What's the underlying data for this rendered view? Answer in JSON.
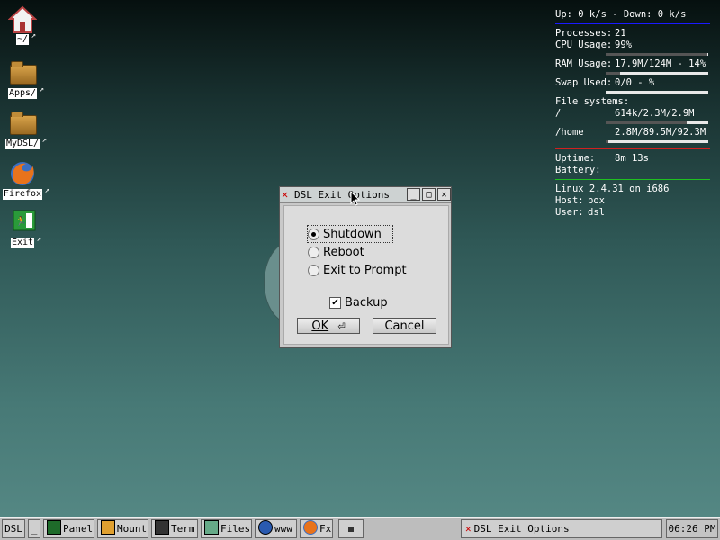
{
  "desktop_icons": [
    {
      "label": "~/",
      "icon": "home-icon"
    },
    {
      "label": "Apps/",
      "icon": "folder-icon"
    },
    {
      "label": "MyDSL/",
      "icon": "folder-icon"
    },
    {
      "label": "Firefox",
      "icon": "firefox-icon"
    },
    {
      "label": "Exit",
      "icon": "exit-icon"
    }
  ],
  "monitor": {
    "network": "Up: 0 k/s - Down: 0 k/s",
    "processes_label": "Processes:",
    "processes": "21",
    "cpu_label": "CPU Usage:",
    "cpu": "99%",
    "cpu_fraction": 0.99,
    "ram_label": "RAM Usage:",
    "ram": "17.9M/124M - 14%",
    "ram_fraction": 0.14,
    "swap_label": "Swap Used:",
    "swap": "0/0 - %",
    "swap_fraction": 0,
    "fs_label": "File systems:",
    "fs_root_label": "/",
    "fs_root": "614k/2.3M/2.9M",
    "fs_root_fraction": 0.79,
    "fs_home_label": "/home",
    "fs_home": "2.8M/89.5M/92.3M",
    "fs_home_fraction": 0.03,
    "uptime_label": "Uptime:",
    "uptime": "8m 13s",
    "battery_label": "Battery:",
    "kernel": "Linux 2.4.31 on i686",
    "host_label": "Host:",
    "host": "box",
    "user_label": "User:",
    "user": "dsl",
    "colors": {
      "blue_line": "#1a1aff",
      "red_line": "#d02020",
      "green_line": "#20c020"
    }
  },
  "dialog": {
    "title": "DSL Exit Options",
    "options": [
      "Shutdown",
      "Reboot",
      "Exit to Prompt"
    ],
    "selected": "Shutdown",
    "backup_label": "Backup",
    "backup_checked": true,
    "ok_label": "OK",
    "cancel_label": "Cancel"
  },
  "taskbar": {
    "start_label": "DSL",
    "minimize_label": "_",
    "items": [
      {
        "label": "Panel",
        "icon": "panel-icon"
      },
      {
        "label": "Mount",
        "icon": "mount-icon"
      },
      {
        "label": "Term",
        "icon": "terminal-icon"
      },
      {
        "label": "Files",
        "icon": "files-icon"
      },
      {
        "label": "www",
        "icon": "globe-icon"
      },
      {
        "label": "Fx",
        "icon": "firefox-icon"
      }
    ],
    "active_window": "DSL Exit Options",
    "clock": "06:26 PM"
  }
}
